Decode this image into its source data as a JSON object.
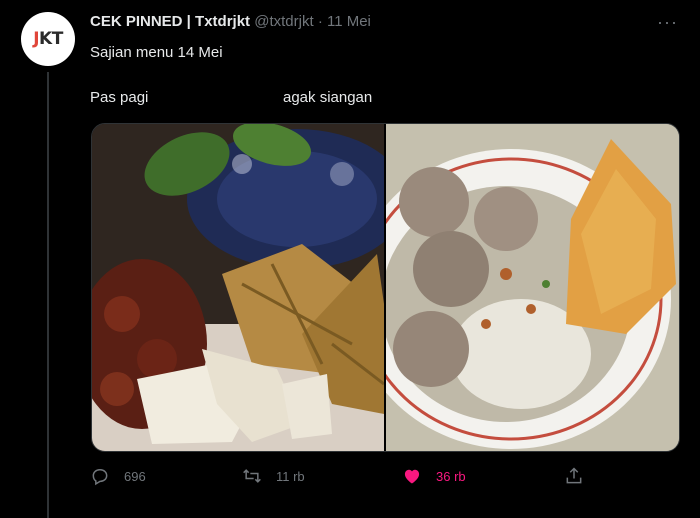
{
  "tweet": {
    "avatar_text": "JKT",
    "display_name": "CEK PINNED | Txtdrjkt",
    "handle": "@txtdrjkt",
    "separator": "·",
    "date": "11 Mei",
    "more_label": "···",
    "text": "Sajian menu 14 Mei",
    "label_left": "Pas pagi",
    "label_right": "agak siangan"
  },
  "media": {
    "left_photo": "ketupat, rendang and lontong",
    "right_photo": "bakso soup with vermicelli and crackers"
  },
  "actions": {
    "reply_count": "696",
    "retweet_count": "11 rb",
    "like_count": "36 rb",
    "like_color": "#f91880"
  },
  "icons": {
    "reply": "reply-icon",
    "retweet": "retweet-icon",
    "like": "heart-icon",
    "share": "share-icon",
    "more": "more-icon"
  }
}
